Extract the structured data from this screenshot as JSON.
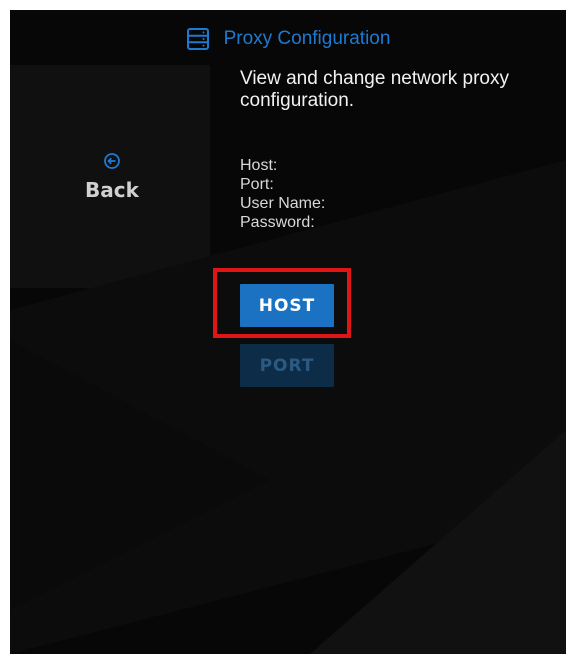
{
  "header": {
    "icon": "server-icon",
    "title": "Proxy Configuration"
  },
  "navigation": {
    "back_icon": "back-arrow-circle-icon",
    "back_label": "Back"
  },
  "content": {
    "description": "View and change network proxy configuration.",
    "fields": [
      "Host:",
      "Port:",
      "User Name:",
      "Password:"
    ]
  },
  "buttons": {
    "host_label": "HOST",
    "port_label": "PORT"
  },
  "colors": {
    "accent": "#1e7ad0",
    "button_active": "#1b72c2",
    "button_dimmed": "#0c2c48",
    "highlight": "#e01616",
    "background": "#070707"
  }
}
